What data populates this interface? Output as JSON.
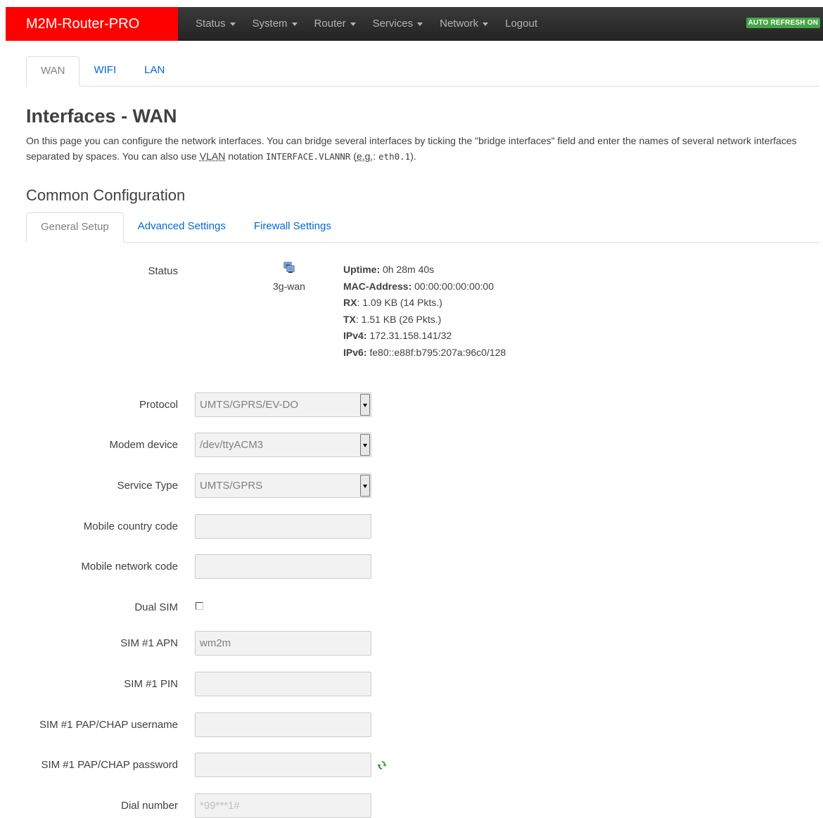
{
  "brand": "M2M-Router-PRO",
  "nav": {
    "items": [
      "Status",
      "System",
      "Router",
      "Services",
      "Network"
    ],
    "logout": "Logout",
    "auto_refresh": "AUTO REFRESH ON"
  },
  "top_tabs": [
    "WAN",
    "WIFI",
    "LAN"
  ],
  "page": {
    "title": "Interfaces - WAN",
    "desc_part1": "On this page you can configure the network interfaces. You can bridge several interfaces by ticking the \"bridge interfaces\" field and enter the names of several network interfaces separated by spaces. You can also use ",
    "desc_vlan": "VLAN",
    "desc_part2": " notation ",
    "desc_code1": "INTERFACE.VLANNR",
    "desc_part3": " (",
    "desc_eg": "e.g.",
    "desc_part4": ": ",
    "desc_code2": "eth0.1",
    "desc_part5": ")."
  },
  "section": {
    "title": "Common Configuration",
    "tabs": [
      "General Setup",
      "Advanced Settings",
      "Firewall Settings"
    ]
  },
  "status": {
    "label": "Status",
    "iface": "3g-wan",
    "uptime_label": "Uptime:",
    "uptime": "0h 28m 40s",
    "mac_label": "MAC-Address:",
    "mac": "00:00:00:00:00:00",
    "rx_label": "RX",
    "rx": ": 1.09 KB (14 Pkts.)",
    "tx_label": "TX",
    "tx": ": 1.51 KB (26 Pkts.)",
    "ipv4_label": "IPv4:",
    "ipv4": "172.31.158.141/32",
    "ipv6_label": "IPv6:",
    "ipv6": "fe80::e88f:b795:207a:96c0/128"
  },
  "form": {
    "protocol_label": "Protocol",
    "protocol": "UMTS/GPRS/EV-DO",
    "modem_label": "Modem device",
    "modem": "/dev/ttyACM3",
    "service_label": "Service Type",
    "service": "UMTS/GPRS",
    "mcc_label": "Mobile country code",
    "mcc": "",
    "mnc_label": "Mobile network code",
    "mnc": "",
    "dualsim_label": "Dual SIM",
    "apn_label": "SIM #1 APN",
    "apn": "wm2m",
    "pin_label": "SIM #1 PIN",
    "pin": "",
    "user_label": "SIM #1 PAP/CHAP username",
    "user": "",
    "pass_label": "SIM #1 PAP/CHAP password",
    "pass": "",
    "dial_label": "Dial number",
    "dial_placeholder": "*99***1#"
  }
}
